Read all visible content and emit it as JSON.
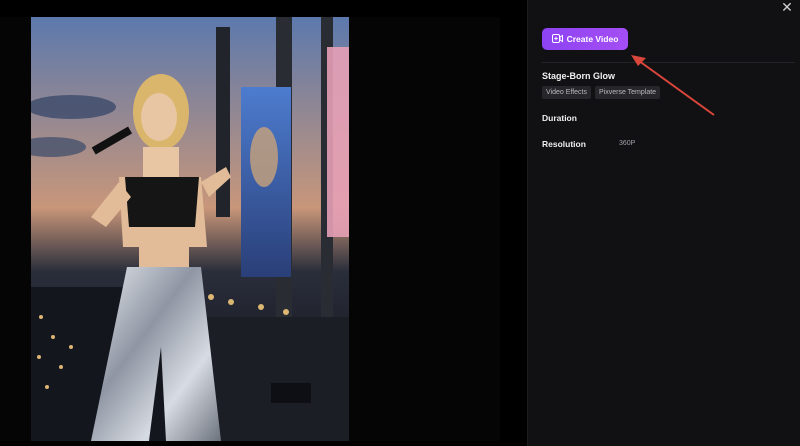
{
  "toolbar": {
    "create_label": "Create Video",
    "close_glyph": "✕"
  },
  "effect": {
    "title": "Stage-Born Glow",
    "tags": [
      "Video Effects",
      "Pixverse Template"
    ]
  },
  "fields": {
    "duration_label": "Duration",
    "resolution_label": "Resolution",
    "resolution_value": "360P"
  },
  "icons": [
    "close-icon",
    "video-add-icon",
    "red-arrow-annotation"
  ],
  "colors": {
    "accent_start": "#8d43f2",
    "accent_end": "#a44ef5",
    "annotation": "#d9463b",
    "panel_bg": "#111113"
  }
}
